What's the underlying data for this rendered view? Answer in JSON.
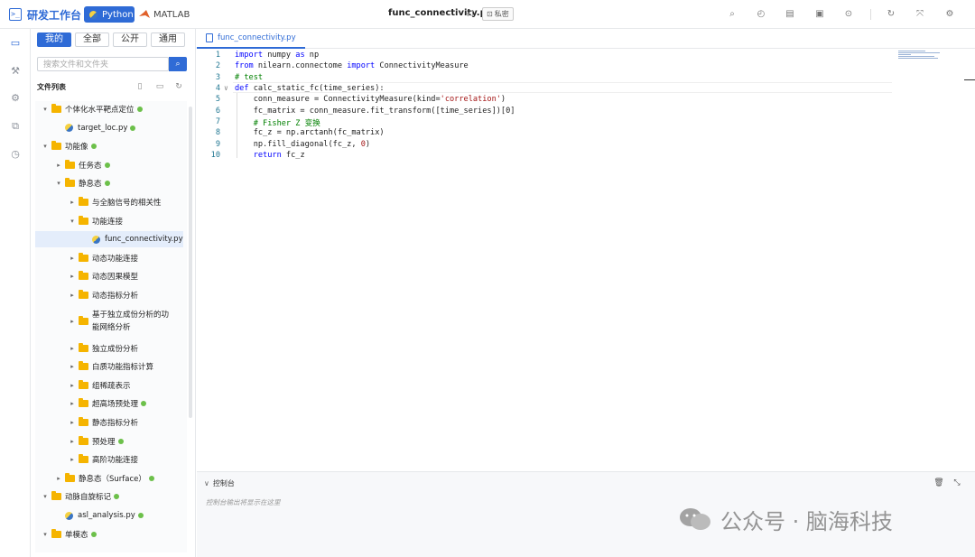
{
  "header": {
    "brand_title": "研发工作台",
    "brand_logo_glyph": ">_",
    "lang_python": "Python",
    "lang_matlab": "MATLAB",
    "file_title": "func_connectivity.py",
    "version": "v1",
    "private_label": "私密",
    "toolbar_icons": [
      "search-icon",
      "history-icon",
      "copy-icon",
      "save-icon",
      "run-icon",
      "refresh-icon",
      "fullscreen-icon",
      "settings-icon"
    ]
  },
  "rail": {
    "icons": [
      "folder-icon",
      "wrench-icon",
      "gear-icon",
      "box-icon",
      "clock-icon"
    ]
  },
  "sidebar": {
    "tabs": [
      "我的",
      "全部",
      "公开",
      "通用"
    ],
    "active_tab": "我的",
    "search_placeholder": "搜索文件和文件夹",
    "list_header": "文件列表",
    "tree": [
      {
        "label": "个体化水平靶点定位",
        "type": "folder",
        "depth": 0,
        "expanded": true,
        "dot": true
      },
      {
        "label": "target_loc.py",
        "type": "py",
        "depth": 1,
        "dot": true
      },
      {
        "label": "功能像",
        "type": "folder",
        "depth": 0,
        "expanded": true,
        "dot": true
      },
      {
        "label": "任务态",
        "type": "folder",
        "depth": 1,
        "expanded": false,
        "dot": true
      },
      {
        "label": "静息态",
        "type": "folder",
        "depth": 1,
        "expanded": true,
        "dot": true
      },
      {
        "label": "与全脑信号的相关性",
        "type": "folder",
        "depth": 2,
        "expanded": false,
        "dot": false
      },
      {
        "label": "功能连接",
        "type": "folder",
        "depth": 2,
        "expanded": true,
        "dot": false
      },
      {
        "label": "func_connectivity.py",
        "type": "py",
        "depth": 3,
        "dot": false,
        "selected": true
      },
      {
        "label": "动态功能连接",
        "type": "folder",
        "depth": 2,
        "expanded": false,
        "dot": false
      },
      {
        "label": "动态因果模型",
        "type": "folder",
        "depth": 2,
        "expanded": false,
        "dot": false
      },
      {
        "label": "动态指标分析",
        "type": "folder",
        "depth": 2,
        "expanded": false,
        "dot": false
      },
      {
        "label": "基于独立成份分析的功能网络分析",
        "type": "folder",
        "depth": 2,
        "expanded": false,
        "dot": false,
        "wrap": true
      },
      {
        "label": "独立成份分析",
        "type": "folder",
        "depth": 2,
        "expanded": false,
        "dot": false
      },
      {
        "label": "白质功能指标计算",
        "type": "folder",
        "depth": 2,
        "expanded": false,
        "dot": false
      },
      {
        "label": "组稀疏表示",
        "type": "folder",
        "depth": 2,
        "expanded": false,
        "dot": false
      },
      {
        "label": "超高场预处理",
        "type": "folder",
        "depth": 2,
        "expanded": false,
        "dot": true
      },
      {
        "label": "静态指标分析",
        "type": "folder",
        "depth": 2,
        "expanded": false,
        "dot": false
      },
      {
        "label": "预处理",
        "type": "folder",
        "depth": 2,
        "expanded": false,
        "dot": true
      },
      {
        "label": "高阶功能连接",
        "type": "folder",
        "depth": 2,
        "expanded": false,
        "dot": false
      },
      {
        "label": "静息态（Surface）",
        "type": "folder",
        "depth": 1,
        "expanded": false,
        "dot": true
      },
      {
        "label": "动脉自旋标记",
        "type": "folder",
        "depth": 0,
        "expanded": true,
        "dot": true
      },
      {
        "label": "asl_analysis.py",
        "type": "py",
        "depth": 1,
        "dot": true
      },
      {
        "label": "单模态",
        "type": "folder",
        "depth": 0,
        "expanded": true,
        "dot": true
      }
    ]
  },
  "editor": {
    "tab_label": "func_connectivity.py",
    "lines": [
      {
        "n": "1",
        "tokens": [
          [
            "kw",
            "import"
          ],
          [
            "t",
            " numpy "
          ],
          [
            "kw",
            "as"
          ],
          [
            "t",
            " np"
          ]
        ]
      },
      {
        "n": "2",
        "tokens": [
          [
            "kw",
            "from"
          ],
          [
            "t",
            " nilearn.connectome "
          ],
          [
            "kw",
            "import"
          ],
          [
            "t",
            " ConnectivityMeasure"
          ]
        ]
      },
      {
        "n": "3",
        "tokens": [
          [
            "cm",
            "# test"
          ]
        ]
      },
      {
        "n": "4",
        "fold": true,
        "tokens": [
          [
            "kw",
            "def"
          ],
          [
            "t",
            " calc_static_fc(time_series):"
          ]
        ]
      },
      {
        "n": "5",
        "tokens": [
          [
            "t",
            "    conn_measure = ConnectivityMeasure(kind="
          ],
          [
            "st",
            "'correlation'"
          ],
          [
            "t",
            ")"
          ]
        ]
      },
      {
        "n": "6",
        "tokens": [
          [
            "t",
            "    fc_matrix = conn_measure.fit_transform([time_series])[0]"
          ]
        ]
      },
      {
        "n": "7",
        "tokens": [
          [
            "cm",
            "    # Fisher Z 变换"
          ]
        ]
      },
      {
        "n": "8",
        "tokens": [
          [
            "t",
            "    fc_z = np.arctanh(fc_matrix)"
          ]
        ]
      },
      {
        "n": "9",
        "tokens": [
          [
            "t",
            "    np.fill_diagonal(fc_z, "
          ],
          [
            "st",
            "0"
          ],
          [
            "t",
            ")"
          ]
        ]
      },
      {
        "n": "10",
        "tokens": [
          [
            "kw",
            "    return"
          ],
          [
            "t",
            " fc_z"
          ]
        ]
      }
    ]
  },
  "console": {
    "title": "控制台",
    "hint": "控制台输出将显示在这里"
  },
  "watermark": {
    "text": "公众号 · 脑海科技"
  }
}
